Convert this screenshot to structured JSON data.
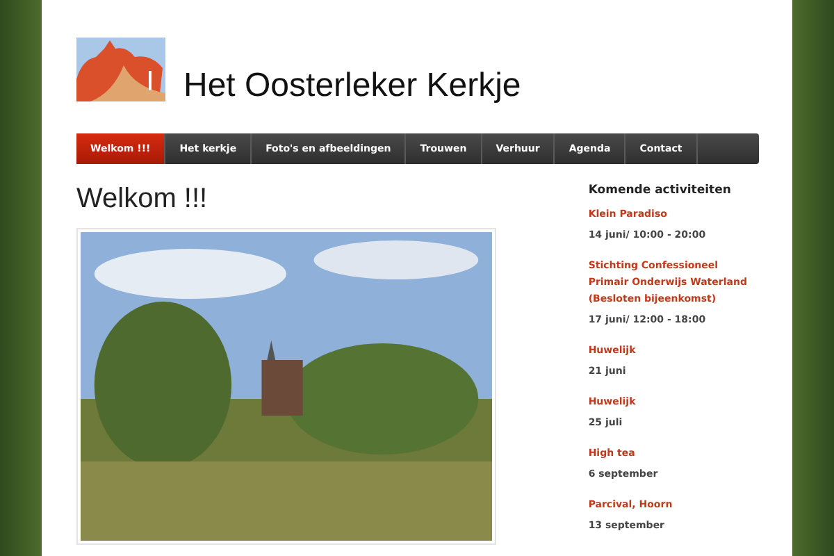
{
  "site_title": "Het Oosterleker Kerkje",
  "nav": [
    {
      "label": "Welkom !!!",
      "selected": true
    },
    {
      "label": "Het kerkje",
      "selected": false
    },
    {
      "label": "Foto's en afbeeldingen",
      "selected": false
    },
    {
      "label": "Trouwen",
      "selected": false
    },
    {
      "label": "Verhuur",
      "selected": false
    },
    {
      "label": "Agenda",
      "selected": false
    },
    {
      "label": "Contact",
      "selected": false
    }
  ],
  "page_heading": "Welkom !!!",
  "sidebar": {
    "heading": "Komende activiteiten",
    "events": [
      {
        "title": "Klein Paradiso",
        "date": "14 juni/ 10:00 - 20:00"
      },
      {
        "title": "Stichting Confessioneel Primair Onderwijs Waterland (Besloten bijeenkomst)",
        "date": "17 juni/ 12:00 - 18:00"
      },
      {
        "title": "Huwelijk",
        "date": "21 juni"
      },
      {
        "title": "Huwelijk",
        "date": "25 juli"
      },
      {
        "title": "High tea",
        "date": "6 september"
      },
      {
        "title": "Parcival, Hoorn",
        "date": "13 september"
      }
    ]
  }
}
